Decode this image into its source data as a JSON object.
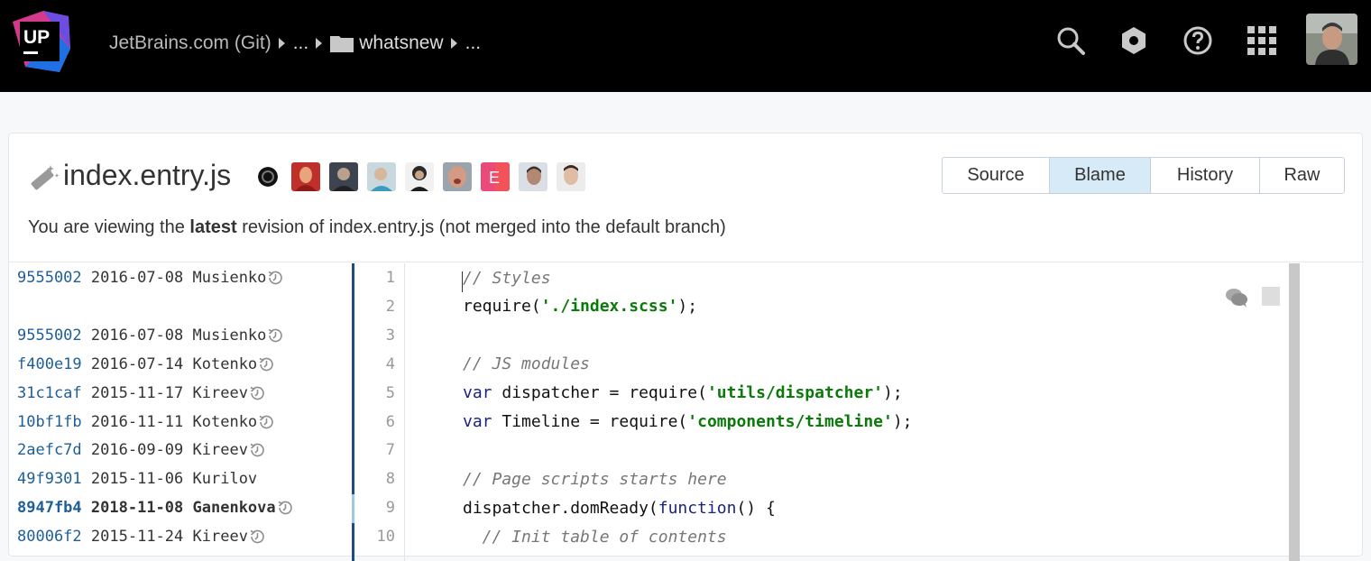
{
  "app": {
    "logo_text": "UP",
    "brand_colors": {
      "accent_blue": "#1f6fe5",
      "accent_pink": "#d43a8c",
      "bar_bg": "#000000"
    }
  },
  "breadcrumb": {
    "items": [
      "JetBrains.com (Git)",
      "...",
      "whatsnew",
      "..."
    ]
  },
  "topbar_icons": [
    "search-icon",
    "settings-icon",
    "help-icon",
    "apps-grid-icon"
  ],
  "file": {
    "name": "index.entry.js",
    "contributors_count": 9,
    "info_prefix": "You are viewing the ",
    "info_bold": "latest",
    "info_suffix": " revision of index.entry.js (not merged into the default branch)"
  },
  "tabs": [
    {
      "label": "Source",
      "active": false
    },
    {
      "label": "Blame",
      "active": true
    },
    {
      "label": "History",
      "active": false
    },
    {
      "label": "Raw",
      "active": false
    }
  ],
  "blame": [
    {
      "line": 1,
      "hash": "9555002",
      "date": "2016-07-08",
      "author": "Musienko",
      "clock": true
    },
    {
      "line": 2,
      "hash": "",
      "date": "",
      "author": "",
      "clock": false
    },
    {
      "line": 3,
      "hash": "9555002",
      "date": "2016-07-08",
      "author": "Musienko",
      "clock": true
    },
    {
      "line": 4,
      "hash": "f400e19",
      "date": "2016-07-14",
      "author": "Kotenko",
      "clock": true
    },
    {
      "line": 5,
      "hash": "31c1caf",
      "date": "2015-11-17",
      "author": "Kireev",
      "clock": true
    },
    {
      "line": 6,
      "hash": "10bf1fb",
      "date": "2016-11-11",
      "author": "Kotenko",
      "clock": true
    },
    {
      "line": 7,
      "hash": "2aefc7d",
      "date": "2016-09-09",
      "author": "Kireev",
      "clock": true
    },
    {
      "line": 8,
      "hash": "49f9301",
      "date": "2015-11-06",
      "author": "Kurilov",
      "clock": false
    },
    {
      "line": 9,
      "hash": "8947fb4",
      "date": "2018-11-08",
      "author": "Ganenkova",
      "clock": true,
      "highlight": true
    },
    {
      "line": 10,
      "hash": "80006f2",
      "date": "2015-11-24",
      "author": "Kireev",
      "clock": true
    }
  ],
  "code": [
    [
      {
        "t": "// Styles",
        "c": "cm"
      }
    ],
    [
      {
        "t": "require(",
        "c": ""
      },
      {
        "t": "'./index.scss'",
        "c": "str"
      },
      {
        "t": ");",
        "c": ""
      }
    ],
    [],
    [
      {
        "t": "// JS modules",
        "c": "cm"
      }
    ],
    [
      {
        "t": "var",
        "c": "kw"
      },
      {
        "t": " dispatcher = require(",
        "c": ""
      },
      {
        "t": "'utils/dispatcher'",
        "c": "str"
      },
      {
        "t": ");",
        "c": ""
      }
    ],
    [
      {
        "t": "var",
        "c": "kw"
      },
      {
        "t": " Timeline = require(",
        "c": ""
      },
      {
        "t": "'components/timeline'",
        "c": "str"
      },
      {
        "t": ");",
        "c": ""
      }
    ],
    [],
    [
      {
        "t": "// Page scripts starts here",
        "c": "cm"
      }
    ],
    [
      {
        "t": "dispatcher.domReady(",
        "c": ""
      },
      {
        "t": "function",
        "c": "kw"
      },
      {
        "t": "() {",
        "c": ""
      }
    ],
    [
      {
        "t": "  // Init table of contents",
        "c": "cm"
      }
    ]
  ]
}
